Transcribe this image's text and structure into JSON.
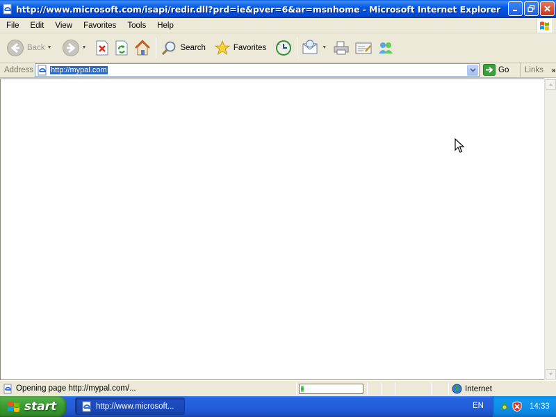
{
  "window": {
    "title": "http://www.microsoft.com/isapi/redir.dll?prd=ie&pver=6&ar=msnhome - Microsoft Internet Explorer"
  },
  "menu": {
    "items": [
      "File",
      "Edit",
      "View",
      "Favorites",
      "Tools",
      "Help"
    ]
  },
  "toolbar": {
    "back_label": "Back",
    "search_label": "Search",
    "favorites_label": "Favorites"
  },
  "address": {
    "label": "Address",
    "url": "http://mypal.com",
    "go_label": "Go",
    "links_label": "Links"
  },
  "status": {
    "text": "Opening page http://mypal.com/...",
    "progress": 0.05,
    "zone": "Internet"
  },
  "taskbar": {
    "start_label": "start",
    "task_label": "http://www.microsoft...",
    "language": "EN",
    "clock": "14:33"
  },
  "colors": {
    "title_bar": "#0054e3",
    "chrome": "#ece9d8",
    "taskbar": "#245edb",
    "start_button": "#3c9c32",
    "tray": "#0f8fe9",
    "url_highlight": "#316ac5"
  }
}
